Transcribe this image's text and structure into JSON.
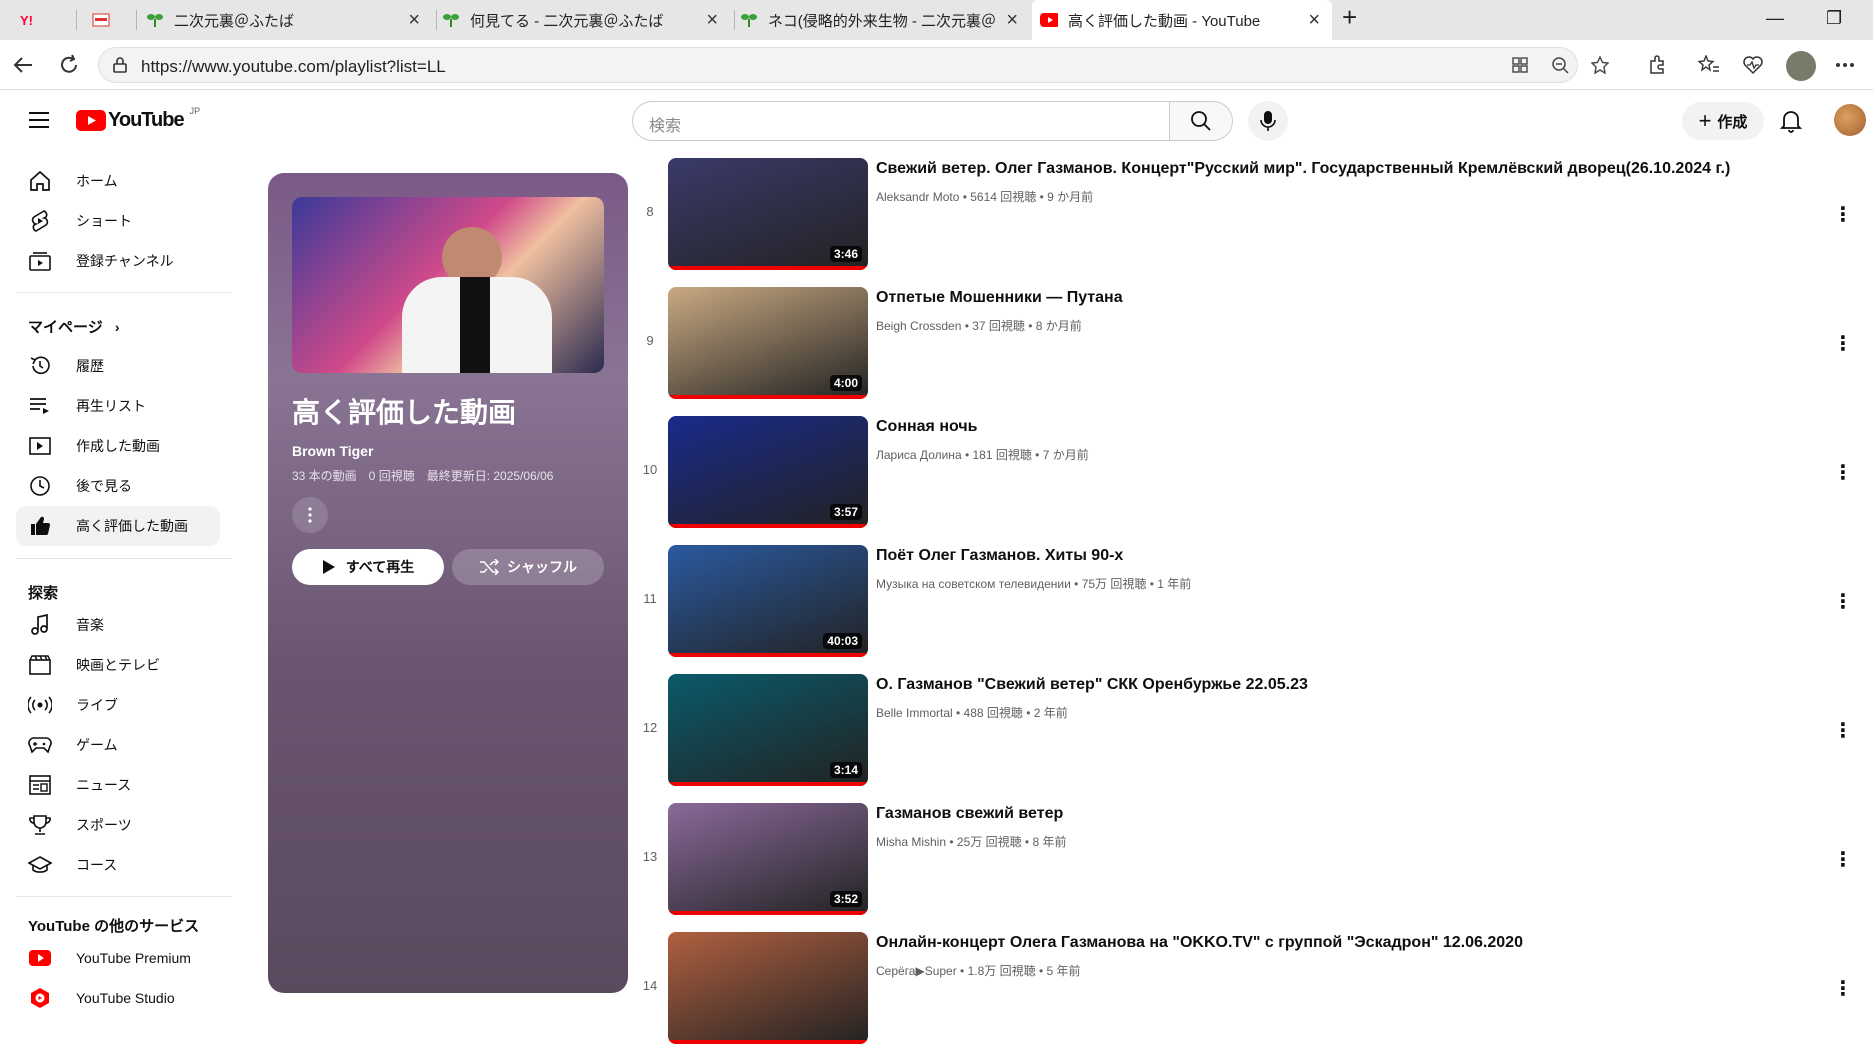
{
  "browser": {
    "tabs": [
      {
        "title": "",
        "favicon": "yahoo-icon"
      },
      {
        "title": "",
        "favicon": "site-icon"
      },
      {
        "title": "二次元裏＠ふたば",
        "favicon": "futaba-icon"
      },
      {
        "title": "何見てる - 二次元裏＠ふたば",
        "favicon": "futaba-icon"
      },
      {
        "title": "ネコ(侵略的外来生物 - 二次元裏＠",
        "favicon": "futaba-icon"
      },
      {
        "title": "高く評価した動画 - YouTube",
        "favicon": "youtube-icon"
      }
    ],
    "url": "https://www.youtube.com/playlist?list=LL"
  },
  "header": {
    "logo": "YouTube",
    "region": "JP",
    "search_placeholder": "検索",
    "create_label": "作成"
  },
  "sidebar": {
    "main": [
      {
        "label": "ホーム",
        "icon": "home-icon"
      },
      {
        "label": "ショート",
        "icon": "shorts-icon"
      },
      {
        "label": "登録チャンネル",
        "icon": "subscriptions-icon"
      }
    ],
    "mypage_heading": "マイページ",
    "mypage": [
      {
        "label": "履歴",
        "icon": "history-icon"
      },
      {
        "label": "再生リスト",
        "icon": "playlists-icon"
      },
      {
        "label": "作成した動画",
        "icon": "your-videos-icon"
      },
      {
        "label": "後で見る",
        "icon": "watch-later-icon"
      },
      {
        "label": "高く評価した動画",
        "icon": "thumbs-up-icon"
      }
    ],
    "explore_heading": "探索",
    "explore": [
      {
        "label": "音楽",
        "icon": "music-icon"
      },
      {
        "label": "映画とテレビ",
        "icon": "movies-icon"
      },
      {
        "label": "ライブ",
        "icon": "live-icon"
      },
      {
        "label": "ゲーム",
        "icon": "gaming-icon"
      },
      {
        "label": "ニュース",
        "icon": "news-icon"
      },
      {
        "label": "スポーツ",
        "icon": "sports-icon"
      },
      {
        "label": "コース",
        "icon": "courses-icon"
      }
    ],
    "more_heading": "YouTube の他のサービス",
    "more": [
      {
        "label": "YouTube Premium",
        "icon": "youtube-premium-icon"
      },
      {
        "label": "YouTube Studio",
        "icon": "youtube-studio-icon"
      }
    ]
  },
  "playlist": {
    "title": "高く評価した動画",
    "owner": "Brown Tiger",
    "meta": "33 本の動画　0 回視聴　最終更新日: 2025/06/06",
    "play_all": "すべて再生",
    "shuffle": "シャッフル"
  },
  "videos": [
    {
      "index": "8",
      "title": "Свежий ветер. Олег Газманов. Концерт\"Русский мир\". Государственный Кремлёвский дворец(26.10.2024 г.)",
      "meta": "Aleksandr Moto • 5614 回視聴 • 9 か月前",
      "duration": "3:46",
      "thumb_color": "#3a3a6a"
    },
    {
      "index": "9",
      "title": "Отпетые Мошенники — Путана",
      "meta": "Beigh Crossden • 37 回視聴 • 8 か月前",
      "duration": "4:00",
      "thumb_color": "#c9a982"
    },
    {
      "index": "10",
      "title": "Сонная ночь",
      "meta": "Лариса Долина • 181 回視聴 • 7 か月前",
      "duration": "3:57",
      "thumb_color": "#1a2a8a"
    },
    {
      "index": "11",
      "title": "Поёт Олег Газманов. Хиты 90-х",
      "meta": "Музыка на советском телевидении • 75万 回視聴 • 1 年前",
      "duration": "40:03",
      "thumb_color": "#2a5aa0"
    },
    {
      "index": "12",
      "title": "О. Газманов \"Свежий ветер\" СКК Оренбуржье 22.05.23",
      "meta": "Belle Immortal • 488 回視聴 • 2 年前",
      "duration": "3:14",
      "thumb_color": "#0a5a6a"
    },
    {
      "index": "13",
      "title": "Газманов свежий ветер",
      "meta": "Misha Mishin • 25万 回視聴 • 8 年前",
      "duration": "3:52",
      "thumb_color": "#8a6a9a"
    },
    {
      "index": "14",
      "title": "Онлайн-концерт Олега Газманова на \"OKKO.TV\" с группой \"Эскадрон\" 12.06.2020",
      "meta": "Серёга▶Super • 1.8万 回視聴 • 5 年前",
      "duration": "",
      "thumb_color": "#b06040"
    }
  ]
}
